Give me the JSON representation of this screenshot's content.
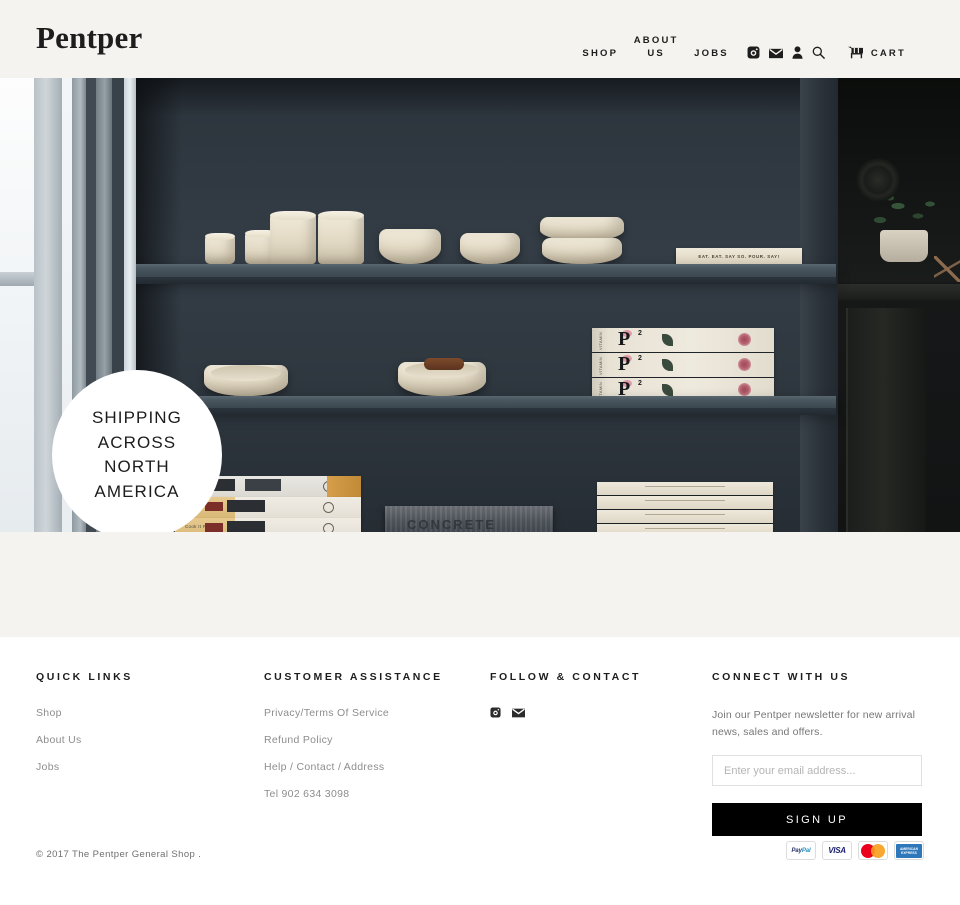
{
  "header": {
    "logo": "Pentper",
    "nav": [
      {
        "label": "SHOP",
        "name": "shop"
      },
      {
        "label": "ABOUT US",
        "name": "about-us"
      },
      {
        "label": "JOBS",
        "name": "jobs"
      }
    ],
    "icons": [
      {
        "name": "instagram-icon",
        "label": "Instagram"
      },
      {
        "name": "mail-icon",
        "label": "Email"
      },
      {
        "name": "account-icon",
        "label": "Account"
      },
      {
        "name": "search-icon",
        "label": "Search"
      }
    ],
    "cart": {
      "label": "CART",
      "icon": "cart-icon"
    }
  },
  "hero": {
    "badge_lines": [
      "SHIPPING",
      "ACROSS",
      "NORTH",
      "AMERICA"
    ],
    "photo_alt": "Dark blue-grey shelving unit with cream ceramic bowls, cups and stacked books beside a window",
    "sign_text": "EAT. EAT. SAY SO. POUR. SAY!",
    "book_concrete": "CONCRETE",
    "book_p2_letter": "P",
    "book_p2_sup": "2",
    "book_p2_spine": "VITAMIN",
    "cookbook_title": "Cook It Raw"
  },
  "footer": {
    "columns": [
      {
        "heading": "QUICK LINKS",
        "name": "quick-links",
        "links": [
          "Shop",
          "About Us",
          "Jobs"
        ]
      },
      {
        "heading": "CUSTOMER ASSISTANCE",
        "name": "customer-assistance",
        "links": [
          "Privacy/Terms Of Service",
          "Refund Policy",
          "Help / Contact / Address",
          "Tel 902 634 3098"
        ]
      },
      {
        "heading": "FOLLOW & CONTACT",
        "name": "follow-and-contact",
        "social": [
          {
            "name": "instagram-icon",
            "label": "Instagram"
          },
          {
            "name": "mail-icon",
            "label": "Email"
          }
        ]
      },
      {
        "heading": "CONNECT WITH US",
        "name": "connect-with-us",
        "newsletter_text": "Join our Pentper newsletter for new arrival news, sales and offers.",
        "email_placeholder": "Enter your email address...",
        "email_value": "",
        "signup_label": "SIGN UP"
      }
    ]
  },
  "bottom": {
    "copyright": "© 2017 The Pentper General Shop .",
    "payments": [
      {
        "name": "paypal-badge",
        "label": "PayPal"
      },
      {
        "name": "visa-badge",
        "label": "VISA"
      },
      {
        "name": "mastercard-badge",
        "label": "Mastercard"
      },
      {
        "name": "amex-badge",
        "label": "AMERICAN EXPRESS"
      }
    ]
  },
  "colors": {
    "page_beige": "#f4f3ef",
    "text_dark": "#1d1d1d",
    "muted": "#8d8d8d",
    "button_black": "#000000",
    "badge_white": "#ffffff"
  }
}
